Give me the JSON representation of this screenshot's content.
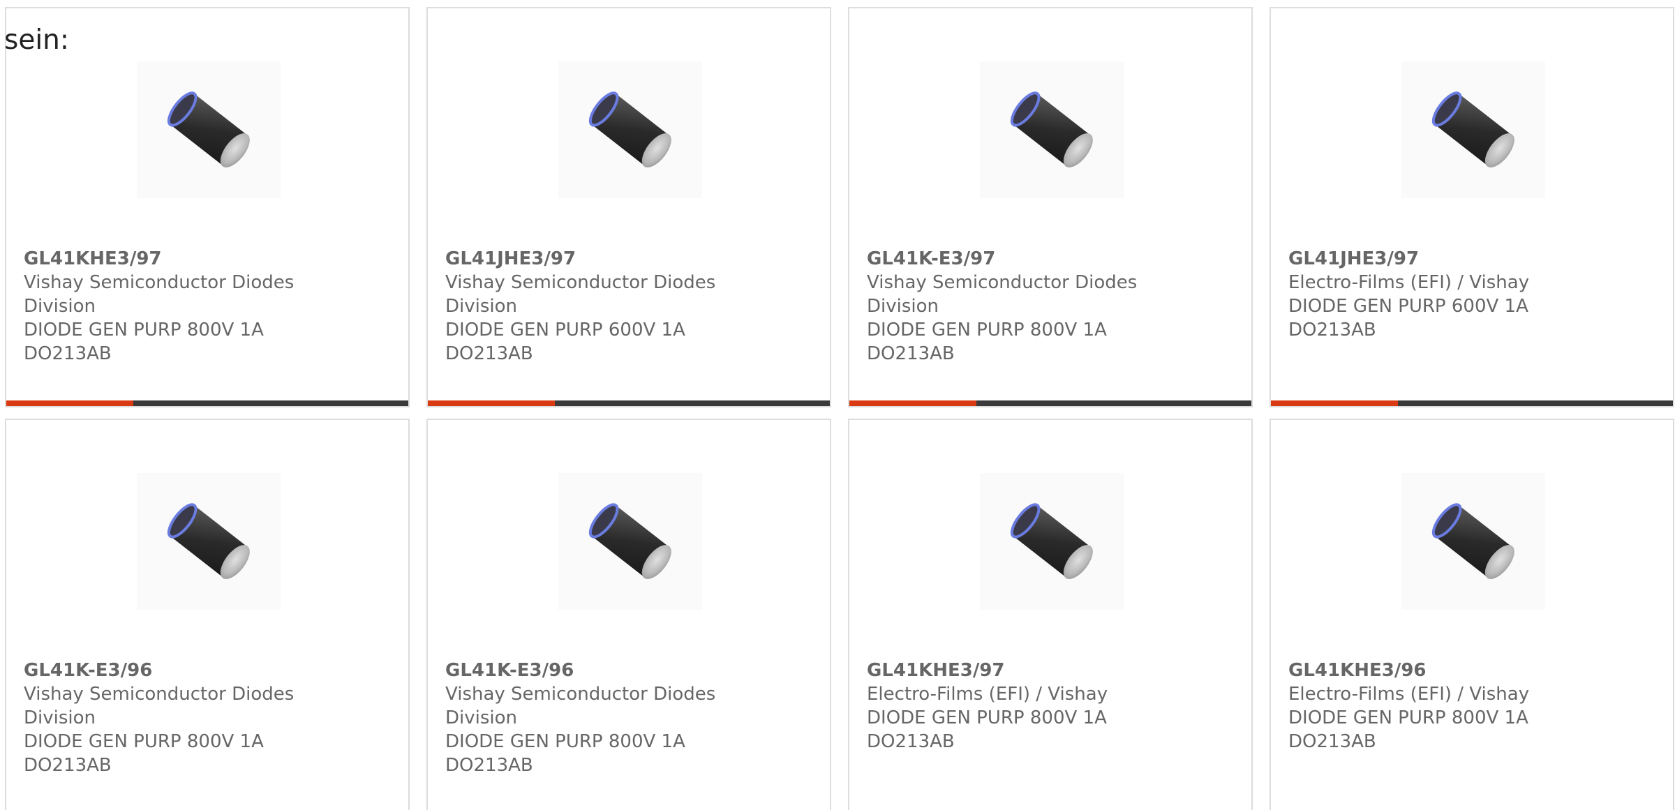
{
  "intro_text": "sein:",
  "colors": {
    "accent_bar": "#d93a12",
    "dark_bar": "#3a3a3a",
    "card_border": "#dddddd",
    "text": "#666666"
  },
  "image_icon": "axial-diode-component-image",
  "cards": [
    {
      "part_number": "GL41KHE3/97",
      "manufacturer": "Vishay Semiconductor Diodes Division",
      "description": "DIODE GEN PURP 800V 1A DO213AB",
      "has_bar": true
    },
    {
      "part_number": "GL41JHE3/97",
      "manufacturer": "Vishay Semiconductor Diodes Division",
      "description": "DIODE GEN PURP 600V 1A DO213AB",
      "has_bar": true
    },
    {
      "part_number": "GL41K-E3/97",
      "manufacturer": "Vishay Semiconductor Diodes Division",
      "description": "DIODE GEN PURP 800V 1A DO213AB",
      "has_bar": true
    },
    {
      "part_number": "GL41JHE3/97",
      "manufacturer": "Electro-Films (EFI) / Vishay",
      "description": "DIODE GEN PURP 600V 1A DO213AB",
      "has_bar": true
    },
    {
      "part_number": "GL41K-E3/96",
      "manufacturer": "Vishay Semiconductor Diodes Division",
      "description": "DIODE GEN PURP 800V 1A DO213AB",
      "has_bar": false
    },
    {
      "part_number": "GL41K-E3/96",
      "manufacturer": "Vishay Semiconductor Diodes Division",
      "description": "DIODE GEN PURP 800V 1A DO213AB",
      "has_bar": false
    },
    {
      "part_number": "GL41KHE3/97",
      "manufacturer": "Electro-Films (EFI) / Vishay",
      "description": "DIODE GEN PURP 800V 1A DO213AB",
      "has_bar": false
    },
    {
      "part_number": "GL41KHE3/96",
      "manufacturer": "Electro-Films (EFI) / Vishay",
      "description": "DIODE GEN PURP 800V 1A DO213AB",
      "has_bar": false
    }
  ]
}
